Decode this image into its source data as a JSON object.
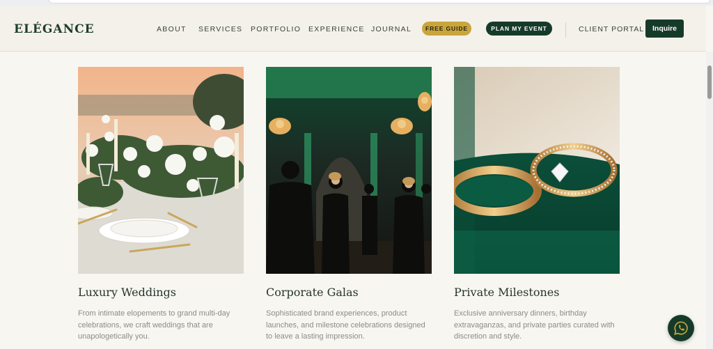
{
  "brand": {
    "logo": "ELÉGANCE"
  },
  "nav": {
    "items": [
      "ABOUT",
      "SERVICES",
      "PORTFOLIO",
      "EXPERIENCE",
      "JOURNAL"
    ],
    "free_guide": "FREE GUIDE",
    "plan_event": "PLAN MY EVENT",
    "client_portal": "CLIENT PORTAL",
    "inquire": "Inquire"
  },
  "services": [
    {
      "title": "Luxury Weddings",
      "description": "From intimate elopements to grand multi-day celebrations, we craft weddings that are unapologetically you."
    },
    {
      "title": "Corporate Galas",
      "description": "Sophisticated brand experiences, product launches, and milestone celebrations designed to leave a lasting impression."
    },
    {
      "title": "Private Milestones",
      "description": "Exclusive anniversary dinners, birthday extravaganzas, and private parties curated with discretion and style."
    }
  ],
  "colors": {
    "brand_green": "#163a2a",
    "gold_accent": "#c9a63c",
    "background": "#f8f6f1"
  },
  "icons": {
    "chat": "whatsapp-icon"
  }
}
